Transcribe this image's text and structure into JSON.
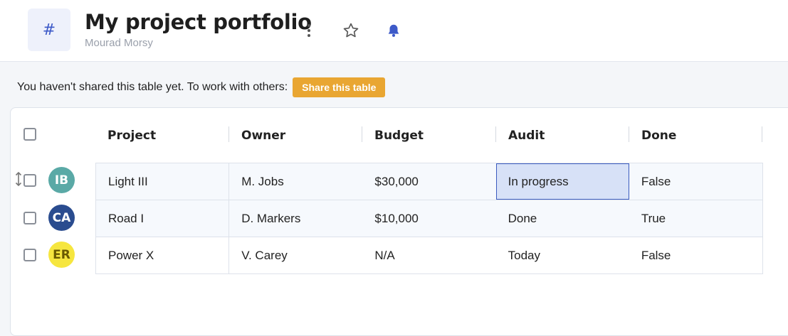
{
  "header": {
    "icon": "hash-icon",
    "title": "My project portfolio",
    "owner": "Mourad Morsy",
    "icons": [
      "more-vertical-icon",
      "star-icon",
      "bell-icon"
    ]
  },
  "share": {
    "text": "You haven't shared this table yet. To work with others:",
    "button": "Share this table"
  },
  "table": {
    "columns": [
      "Project",
      "Owner",
      "Budget",
      "Audit",
      "Done"
    ],
    "rows": [
      {
        "initials": "IB",
        "avatar_color": "#5aa9a6",
        "avatar_text": "#ffffff",
        "cells": [
          "Light III",
          "M. Jobs",
          "$30,000",
          "In progress",
          "False"
        ]
      },
      {
        "initials": "CA",
        "avatar_color": "#2a4c8f",
        "avatar_text": "#ffffff",
        "cells": [
          "Road I",
          "D. Markers",
          "$10,000",
          "Done",
          "True"
        ]
      },
      {
        "initials": "ER",
        "avatar_color": "#f6e63f",
        "avatar_text": "#6a5a00",
        "cells": [
          "Power X",
          "V. Carey",
          "N/A",
          "Today",
          "False"
        ]
      }
    ]
  },
  "colors": {
    "accent": "#3d5ac8",
    "share_button": "#e9a632",
    "selected_cell": "#d7e1f7"
  }
}
